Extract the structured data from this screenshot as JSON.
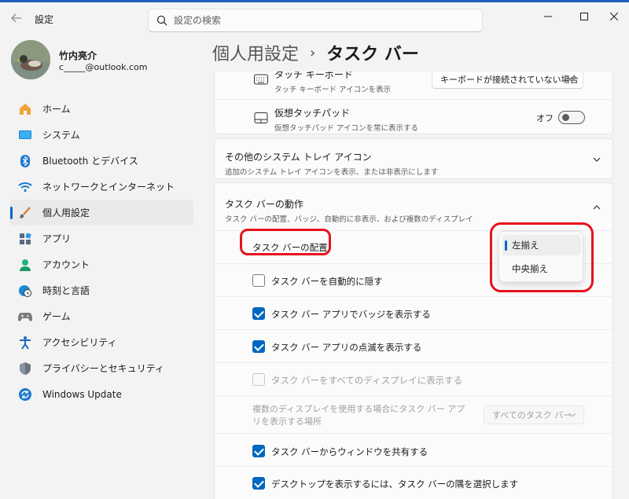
{
  "window": {
    "title": "設定"
  },
  "search": {
    "placeholder": "設定の検索"
  },
  "profile": {
    "name": "竹内亮介",
    "email": "c_____@outlook.com"
  },
  "nav": [
    {
      "label": "ホーム",
      "icon": "home-icon"
    },
    {
      "label": "システム",
      "icon": "system-icon"
    },
    {
      "label": "Bluetooth とデバイス",
      "icon": "bluetooth-icon"
    },
    {
      "label": "ネットワークとインターネット",
      "icon": "wifi-icon"
    },
    {
      "label": "個人用設定",
      "icon": "brush-icon",
      "active": true
    },
    {
      "label": "アプリ",
      "icon": "apps-icon"
    },
    {
      "label": "アカウント",
      "icon": "account-icon"
    },
    {
      "label": "時刻と言語",
      "icon": "clock-globe-icon"
    },
    {
      "label": "ゲーム",
      "icon": "gamepad-icon"
    },
    {
      "label": "アクセシビリティ",
      "icon": "accessibility-icon"
    },
    {
      "label": "プライバシーとセキュリティ",
      "icon": "shield-icon"
    },
    {
      "label": "Windows Update",
      "icon": "update-icon"
    }
  ],
  "header": {
    "parent": "個人用設定",
    "current": "タスク バー"
  },
  "touch_keyboard": {
    "title": "タッチ キーボード",
    "desc": "タッチ キーボード アイコンを表示",
    "value": "キーボードが接続されていない場合"
  },
  "virtual_touchpad": {
    "title": "仮想タッチパッド",
    "desc": "仮想タッチパッド アイコンを常に表示する",
    "state": "オフ"
  },
  "other_tray": {
    "title": "その他のシステム トレイ アイコン",
    "desc": "追加のシステム トレイ アイコンを表示、または非表示にします"
  },
  "behavior": {
    "title": "タスク バーの動作",
    "desc": "タスク バーの配置、バッジ、自動的に非表示、および複数のディスプレイ",
    "alignment_label": "タスク バーの配置",
    "alignment_options": [
      "左揃え",
      "中央揃え"
    ],
    "alignment_selected": "左揃え",
    "options": [
      {
        "label": "タスク バーを自動的に隠す",
        "checked": false,
        "disabled": false
      },
      {
        "label": "タスク バー アプリでバッジを表示する",
        "checked": true,
        "disabled": false
      },
      {
        "label": "タスク バー アプリの点滅を表示する",
        "checked": true,
        "disabled": false
      },
      {
        "label": "タスク バーをすべてのディスプレイに表示する",
        "checked": false,
        "disabled": true
      }
    ],
    "multi_display_label": "複数のディスプレイを使用する場合にタスク バー アプリを表示する場所",
    "multi_display_value": "すべてのタスク バー",
    "options2": [
      {
        "label": "タスク バーからウィンドウを共有する",
        "checked": true
      },
      {
        "label": "デスクトップを表示するには、タスク バーの隅を選択します",
        "checked": true
      }
    ]
  },
  "colors": {
    "accent": "#0067c0",
    "highlight": "#e8121c"
  }
}
